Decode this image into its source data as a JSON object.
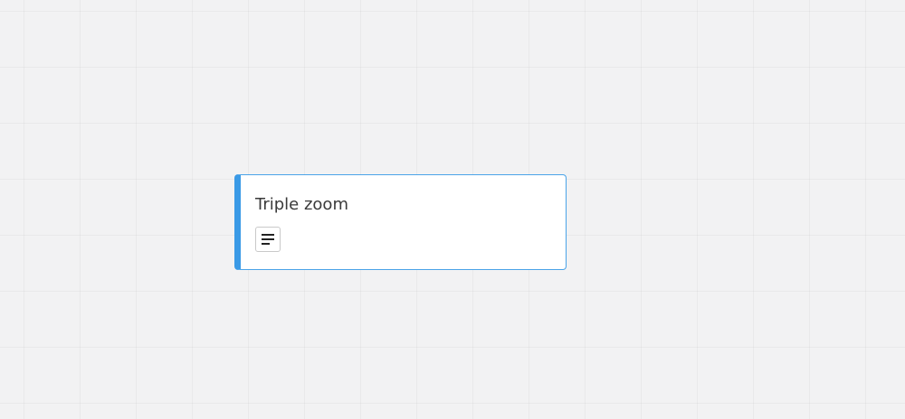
{
  "board": {
    "background_color": "#f2f2f3"
  },
  "card": {
    "title": "Triple zoom",
    "accent_color": "#3a9ae6",
    "border_color": "#4aa3e8",
    "description_icon": "description-icon"
  }
}
